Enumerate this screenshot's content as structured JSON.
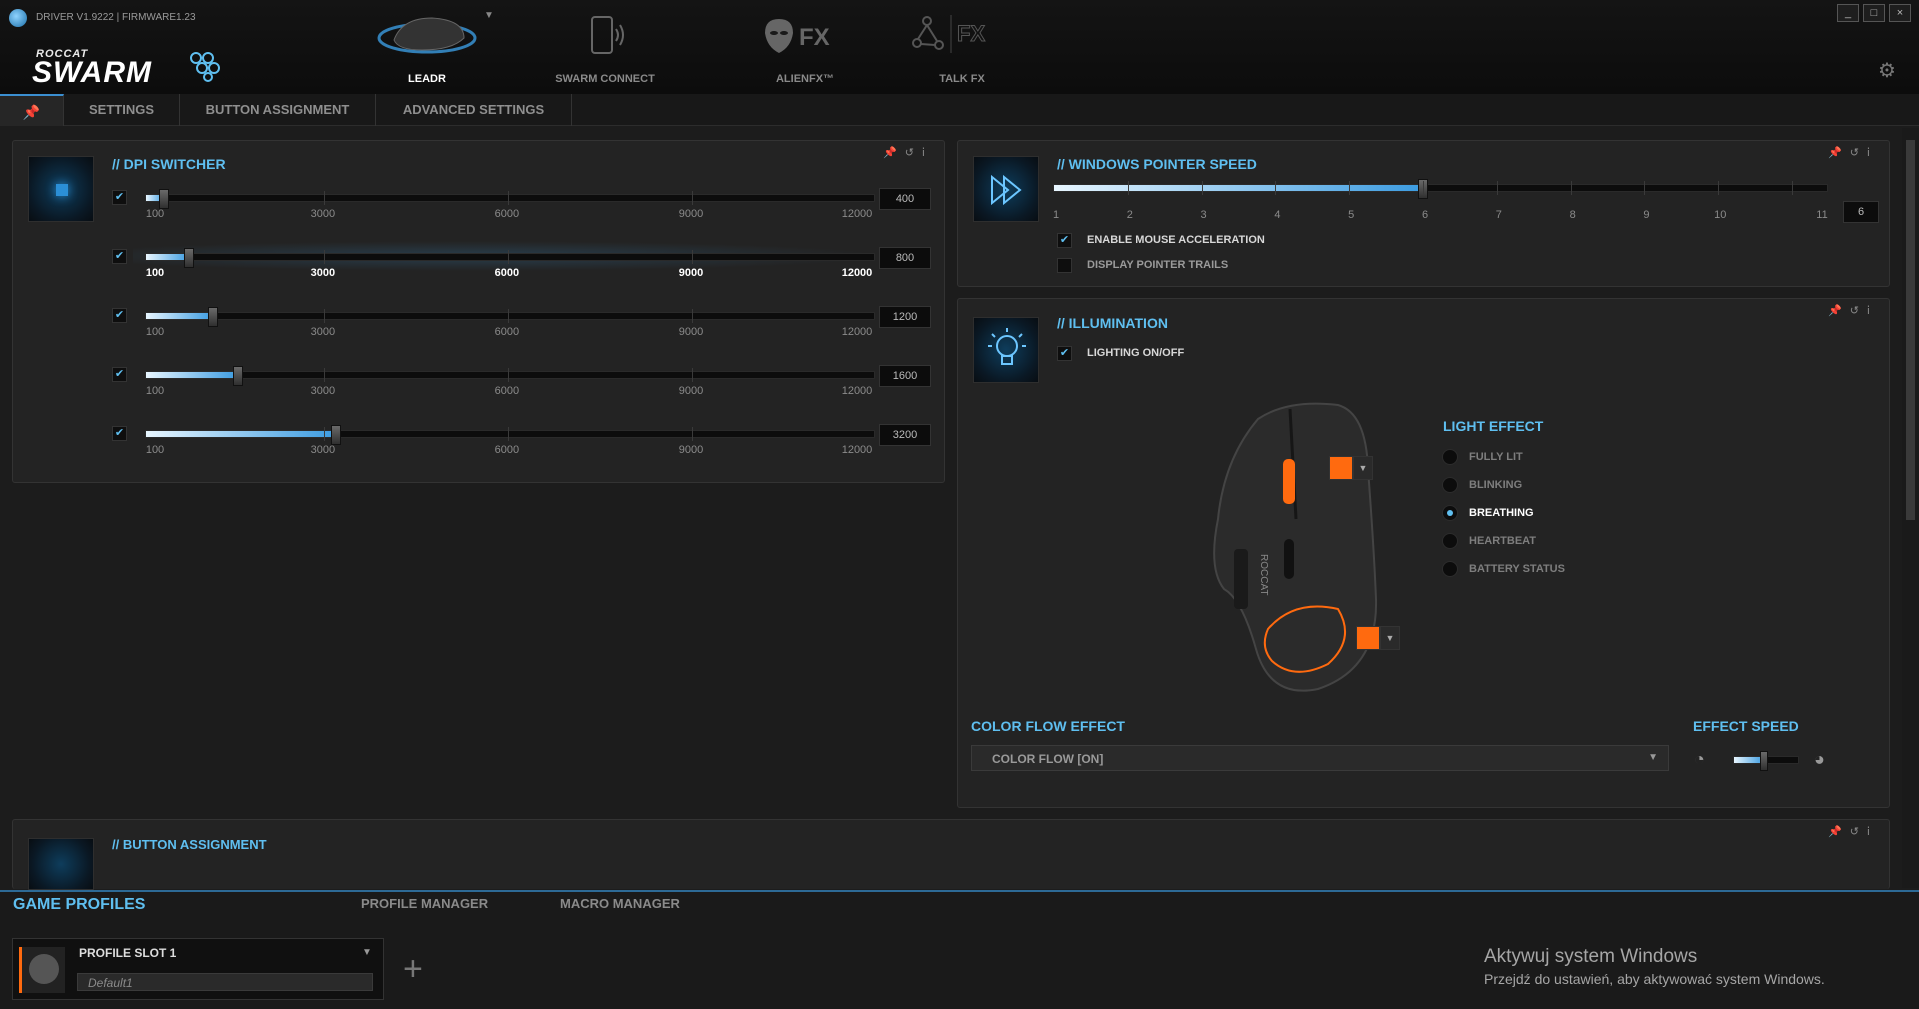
{
  "app": {
    "version_text": "DRIVER V1.9222 | FIRMWARE1.23",
    "logo_small": "ROCCAT",
    "logo_big": "SWARM"
  },
  "window_controls": {
    "minimize": "_",
    "restore": "□",
    "close": "×"
  },
  "nav": [
    {
      "label": "LEADR",
      "icon": "mouse-icon",
      "active": true
    },
    {
      "label": "SWARM CONNECT",
      "icon": "phone-icon",
      "active": false
    },
    {
      "label": "ALIENFX™",
      "icon": "alienfx-icon",
      "active": false
    },
    {
      "label": "TALK FX",
      "icon": "talkfx-icon",
      "active": false
    }
  ],
  "tabs": [
    "SETTINGS",
    "BUTTON ASSIGNMENT",
    "ADVANCED SETTINGS"
  ],
  "dpi": {
    "title": "// DPI SWITCHER",
    "tick_labels": [
      "100",
      "3000",
      "6000",
      "9000",
      "12000"
    ],
    "rows": [
      {
        "checked": true,
        "value": "400",
        "level": 400,
        "highlight": false
      },
      {
        "checked": true,
        "value": "800",
        "level": 800,
        "highlight": true
      },
      {
        "checked": true,
        "value": "1200",
        "level": 1200,
        "highlight": false
      },
      {
        "checked": true,
        "value": "1600",
        "level": 1600,
        "highlight": false
      },
      {
        "checked": true,
        "value": "3200",
        "level": 3200,
        "highlight": false
      }
    ]
  },
  "pointer": {
    "title": "// WINDOWS POINTER SPEED",
    "tick_labels": [
      "1",
      "2",
      "3",
      "4",
      "5",
      "6",
      "7",
      "8",
      "9",
      "10",
      "11"
    ],
    "value": "6",
    "level": 6,
    "options": [
      {
        "label": "ENABLE MOUSE ACCELERATION",
        "checked": true
      },
      {
        "label": "DISPLAY POINTER TRAILS",
        "checked": false
      }
    ]
  },
  "illumination": {
    "title": "// ILLUMINATION",
    "lighting_label": "LIGHTING ON/OFF",
    "lighting_checked": true,
    "light_effect_title": "LIGHT EFFECT",
    "effects": [
      {
        "label": "FULLY LIT",
        "selected": false
      },
      {
        "label": "BLINKING",
        "selected": false
      },
      {
        "label": "BREATHING",
        "selected": true
      },
      {
        "label": "HEARTBEAT",
        "selected": false
      },
      {
        "label": "BATTERY STATUS",
        "selected": false
      }
    ],
    "color_flow_title": "COLOR FLOW EFFECT",
    "color_flow_value": "COLOR FLOW [ON]",
    "effect_speed_title": "EFFECT SPEED",
    "effect_speed_level": 0.45,
    "zone_color": "#ff6a0f",
    "mouse_brand": "ROCCAT"
  },
  "button_assignment": {
    "title": "// BUTTON ASSIGNMENT"
  },
  "bottom": {
    "tabs": [
      "GAME PROFILES",
      "PROFILE MANAGER",
      "MACRO MANAGER"
    ],
    "profile_name": "PROFILE SLOT 1",
    "profile_sub": "Default1",
    "add_label": "+",
    "activation_title": "Aktywuj system Windows",
    "activation_sub": "Przejdź do ustawień, aby aktywować system Windows."
  },
  "colors": {
    "accent": "#5fbff0",
    "background": "#1c1c1c"
  }
}
